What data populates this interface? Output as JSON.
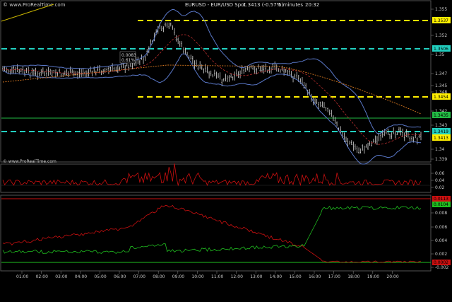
{
  "header": {
    "watermark_top": "© www.ProRealTime.com",
    "title": "EURUSD - EUR/USD Spot",
    "price_change": "1.3413 (-0.57%)",
    "interval": "5 minutes",
    "time": "20:32"
  },
  "watermark_bottom": "© www.ProRealTime.com",
  "colors": {
    "background": "#000000",
    "price_bars": "#d8d8d8",
    "bollinger": "#5a78c8",
    "moving_avg_short": "#c03030",
    "moving_avg_long": "#d87820",
    "dashed_yellow": "#ffee00",
    "dashed_cyan": "#22d0c0",
    "solid_green_line": "#22bb44",
    "indicator_red": "#cc1010",
    "indicator_green": "#20c020",
    "axis_text": "#c8c8c8"
  },
  "annotations": {
    "box_a": "0.0083",
    "box_b": "0.61%"
  },
  "price_axis": {
    "ticks": [
      "1.355",
      "1.352",
      "1.35",
      "1.347",
      "1.345",
      "1.342",
      "1.34",
      "1.339",
      "1.348",
      "1.343"
    ],
    "level_labels": [
      {
        "value": "1.3537",
        "style": "yellow"
      },
      {
        "value": "1.3506",
        "style": "cyan"
      },
      {
        "value": "1.3454",
        "style": "yellow"
      },
      {
        "value": "1.3435",
        "style": "green"
      },
      {
        "value": "1.3419",
        "style": "cyan"
      },
      {
        "value": "1.3413",
        "style": "yellow"
      }
    ]
  },
  "indicator1_axis": {
    "ticks": [
      "0.06",
      "0.04",
      "0.02"
    ]
  },
  "indicator2_axis": {
    "ticks": [
      "0.008",
      "0.006",
      "0.004",
      "0.002",
      "-0.002"
    ],
    "labels": [
      {
        "value": "0.0113",
        "style": "red"
      },
      {
        "value": "0.0104",
        "style": "green"
      },
      {
        "value": "0.0002",
        "style": "red"
      }
    ]
  },
  "time_axis": {
    "ticks": [
      "01:00",
      "02:00",
      "03:00",
      "04:00",
      "05:00",
      "06:00",
      "07:00",
      "08:00",
      "09:00",
      "10:00",
      "11:00",
      "12:00",
      "13:00",
      "14:00",
      "15:00",
      "16:00",
      "17:00",
      "18:00",
      "19:00",
      "20:00"
    ]
  }
}
